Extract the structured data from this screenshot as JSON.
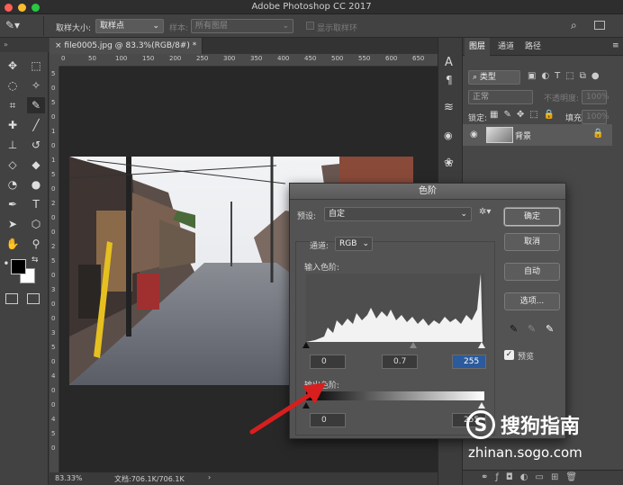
{
  "window": {
    "title": "Adobe Photoshop CC 2017"
  },
  "options_bar": {
    "sample_size_label": "取样大小:",
    "sample_size_value": "取样点",
    "sample_label": "样本:",
    "sample_value": "所有图层",
    "show_ring_label": "显示取样环"
  },
  "document": {
    "tab_title": "file0005.jpg @ 83.3%(RGB/8#) *",
    "ruler_ticks": [
      "0",
      "50",
      "100",
      "150",
      "200",
      "250",
      "300",
      "350",
      "400",
      "450",
      "500",
      "550",
      "600",
      "650"
    ],
    "vruler_ticks": [
      "5",
      "0",
      "5",
      "0",
      "1",
      "0",
      "1",
      "5",
      "0",
      "2",
      "0",
      "0",
      "2",
      "5",
      "0",
      "3",
      "0",
      "0",
      "3",
      "5",
      "0",
      "4",
      "0",
      "0",
      "4",
      "5",
      "0"
    ]
  },
  "status_bar": {
    "zoom": "83.33%",
    "doc_info": "文档:706.1K/706.1K"
  },
  "layers_panel": {
    "tabs": [
      "图层",
      "通道",
      "路径"
    ],
    "filter_label": "类型",
    "blend_mode": "正常",
    "opacity_label": "不透明度:",
    "opacity_value": "100%",
    "lock_label": "锁定:",
    "fill_label": "填充:",
    "fill_value": "100%",
    "layer_name": "背景"
  },
  "levels_dialog": {
    "title": "色阶",
    "preset_label": "预设:",
    "preset_value": "自定",
    "channel_label": "通道:",
    "channel_value": "RGB",
    "input_levels_label": "输入色阶:",
    "input_black": "0",
    "input_gamma": "0.7",
    "input_white": "255",
    "output_levels_label": "输出色阶:",
    "output_black": "0",
    "output_white": "255",
    "ok_button": "确定",
    "cancel_button": "取消",
    "auto_button": "自动",
    "options_button": "选项...",
    "preview_label": "预览",
    "preview_checked": true
  },
  "watermark": {
    "brand": "搜狗指南",
    "url": "zhinan.sogo.com"
  }
}
